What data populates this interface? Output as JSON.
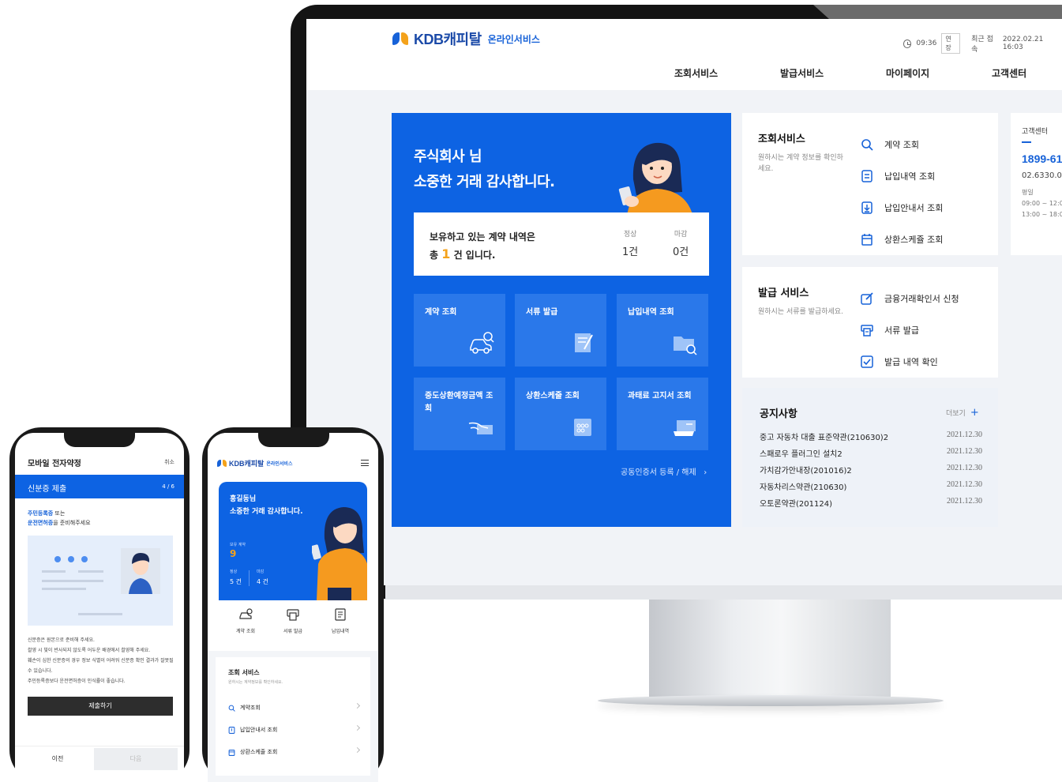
{
  "desktop": {
    "brand": {
      "name": "KDB캐피탈",
      "service": "온라인서비스"
    },
    "util": {
      "time": "09:36",
      "extend_label": "연장",
      "last_login_label": "최근 접속",
      "last_login": "2022.02.21 16:03"
    },
    "nav": [
      "조회서비스",
      "발급서비스",
      "마이페이지",
      "고객센터"
    ],
    "hero": {
      "greeting": "주식회사 님",
      "thanks": "소중한 거래 감사합니다.",
      "summary_line1": "보유하고 있는 계약 내역은",
      "summary_prefix": "총",
      "summary_count": "1",
      "summary_suffix": "건 입니다.",
      "stats": [
        {
          "label": "정상",
          "value": "1건"
        },
        {
          "label": "마감",
          "value": "0건"
        }
      ],
      "tiles": [
        "계약 조회",
        "서류 발급",
        "납입내역 조회",
        "중도상환예정금액 조회",
        "상환스케줄 조회",
        "과태료 고지서 조회"
      ],
      "cert_link": "공동인증서 등록 / 해제"
    },
    "inquiry": {
      "title": "조회서비스",
      "desc": "원하시는 계약 정보를 확인하세요.",
      "links": [
        "계약 조회",
        "납입내역 조회",
        "납입안내서 조회",
        "상환스케쥴 조회"
      ]
    },
    "issue": {
      "title": "발급 서비스",
      "desc": "원하시는 서류를 발급하세요.",
      "links": [
        "금융거래확인서 신청",
        "서류 발급",
        "발급 내역 확인"
      ]
    },
    "customer_center": {
      "title": "고객센터",
      "phone": "1899-61",
      "fax": "02.6330.01",
      "days": "평일",
      "hours1": "09:00 ~ 12:0",
      "hours2": "13:00 ~ 18:0"
    },
    "notice": {
      "title": "공지사항",
      "more": "더보기",
      "items": [
        {
          "title": "중고 자동차 대출 표준약관(210630)2",
          "date": "2021.12.30"
        },
        {
          "title": "스패로우 플러그인 설치2",
          "date": "2021.12.30"
        },
        {
          "title": "가치감가안내장(201016)2",
          "date": "2021.12.30"
        },
        {
          "title": "자동차리스약관(210630)",
          "date": "2021.12.30"
        },
        {
          "title": "오토론약관(201124)",
          "date": "2021.12.30"
        }
      ]
    }
  },
  "phone1": {
    "title": "모바일 전자약정",
    "cancel": "취소",
    "step_title": "신분증 제출",
    "step": "4 / 6",
    "guide_id": "주민등록증",
    "guide_or": " 또는",
    "guide_license": "운전면허증",
    "guide_tail": "을 준비해주세요",
    "notes": [
      "신분증은 원본으로 준비해 주세요.",
      "촬영 시 빛이 반사되지 않도록 어두운 배경에서 촬영해 주세요.",
      "훼손이 심한 신분증의 경우 정보 식별이 어려워 신분증 확인 결과가 잘못될 수 있습니다.",
      "주민등록증보다 운전면허증이 인식률이 좋습니다."
    ],
    "submit": "제출하기",
    "prev": "이전",
    "next": "다음"
  },
  "phone2": {
    "brand": {
      "name": "KDB캐피탈",
      "service": "온라인서비스"
    },
    "hero": {
      "name": "홍길동님",
      "thanks": "소중한 거래 감사합니다.",
      "hold_label": "보유 계약",
      "hold_value": "9",
      "normal_label": "정상",
      "normal_value": "5 건",
      "closed_label": "마감",
      "closed_value": "4 건"
    },
    "quick": [
      "계약 조회",
      "서류 발급",
      "납입내역"
    ],
    "panel": {
      "title": "조회 서비스",
      "desc": "원하시는 계약정보를 확인하세요.",
      "items": [
        "계약조회",
        "납입안내서 조회",
        "상환스케줄 조회"
      ]
    }
  },
  "colors": {
    "primary": "#0d63e3",
    "accent": "#f4a21b",
    "tile": "#2a78ea"
  }
}
